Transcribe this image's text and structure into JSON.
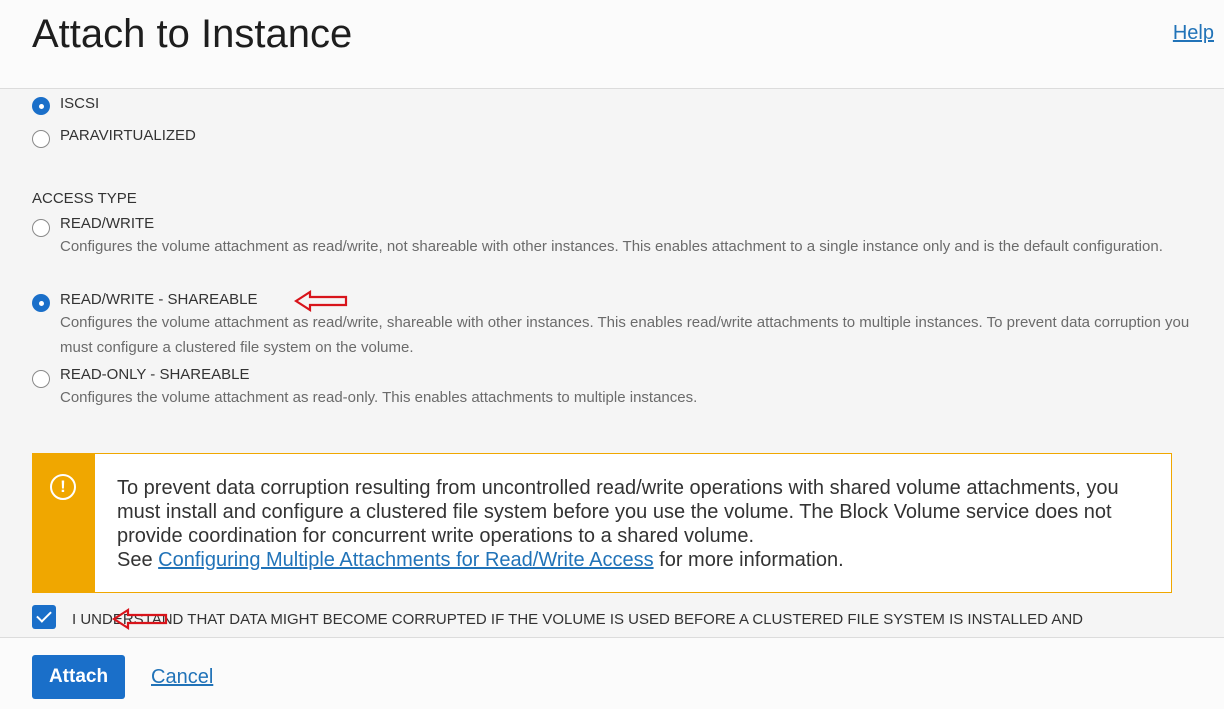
{
  "header": {
    "title": "Attach to Instance",
    "help": "Help"
  },
  "attachment_type": {
    "options": [
      {
        "label": "ISCSI",
        "checked": true
      },
      {
        "label": "PARAVIRTUALIZED",
        "checked": false
      }
    ]
  },
  "access_type": {
    "label": "ACCESS TYPE",
    "options": [
      {
        "label": "READ/WRITE",
        "checked": false,
        "description": "Configures the volume attachment as read/write, not shareable with other instances. This enables attachment to a single instance only and is the default configuration."
      },
      {
        "label": "READ/WRITE - SHAREABLE",
        "checked": true,
        "description": "Configures the volume attachment as read/write, shareable with other instances. This enables read/write attachments to multiple instances. To prevent data corruption you must configure a clustered file system on the volume."
      },
      {
        "label": "READ-ONLY - SHAREABLE",
        "checked": false,
        "description": "Configures the volume attachment as read-only. This enables attachments to multiple instances."
      }
    ]
  },
  "warning": {
    "icon": "exclamation-circle-icon",
    "text": "To prevent data corruption resulting from uncontrolled read/write operations with shared volume attachments, you must install and configure a clustered file system before you use the volume. The Block Volume service does not provide coordination for concurrent write operations to a shared volume.",
    "see_prefix": "See ",
    "link": "Configuring Multiple Attachments for Read/Write Access",
    "see_suffix": " for more information.",
    "color": "#f0a700"
  },
  "confirm": {
    "checked": true,
    "label": "I UNDERSTAND THAT DATA MIGHT BECOME CORRUPTED IF THE VOLUME IS USED BEFORE A CLUSTERED FILE SYSTEM IS INSTALLED AND CONFIGURED"
  },
  "footer": {
    "attach": "Attach",
    "cancel": "Cancel"
  },
  "colors": {
    "accent": "#1a6fc9",
    "link": "#2173b8",
    "annotation_arrow": "#d8141b"
  }
}
